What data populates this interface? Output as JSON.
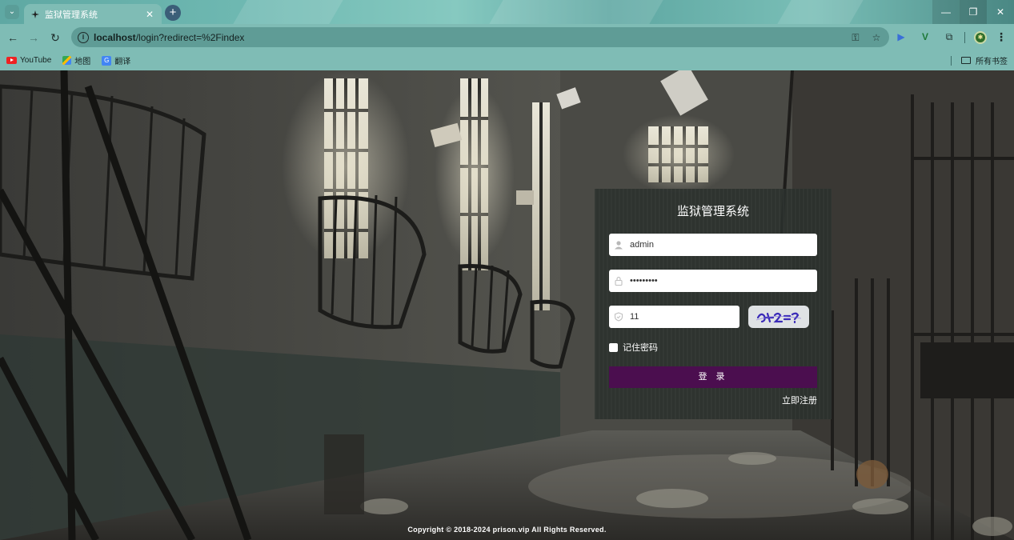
{
  "browser": {
    "tab": {
      "title": "监狱管理系统"
    },
    "url": {
      "host": "localhost",
      "path": "/login?redirect=%2Findex"
    },
    "bookmarks": [
      {
        "label": "YouTube",
        "icon": "youtube-icon"
      },
      {
        "label": "地图",
        "icon": "maps-icon"
      },
      {
        "label": "翻译",
        "icon": "translate-icon"
      }
    ],
    "all_bookmarks_label": "所有书签"
  },
  "login": {
    "title": "监狱管理系统",
    "username": {
      "value": "admin",
      "icon": "user-icon"
    },
    "password": {
      "value": "•••••••••",
      "icon": "lock-icon"
    },
    "captcha": {
      "value": "11",
      "icon": "shield-icon",
      "image_text": "9+2=?"
    },
    "remember_label": "记住密码",
    "remember_checked": false,
    "submit_label": "登 录",
    "register_label": "立即注册",
    "colors": {
      "button": "#4b0e4f",
      "panel": "#2a302c"
    }
  },
  "footer": {
    "copyright": "Copyright © 2018-2024 prison.vip All Rights Reserved."
  }
}
